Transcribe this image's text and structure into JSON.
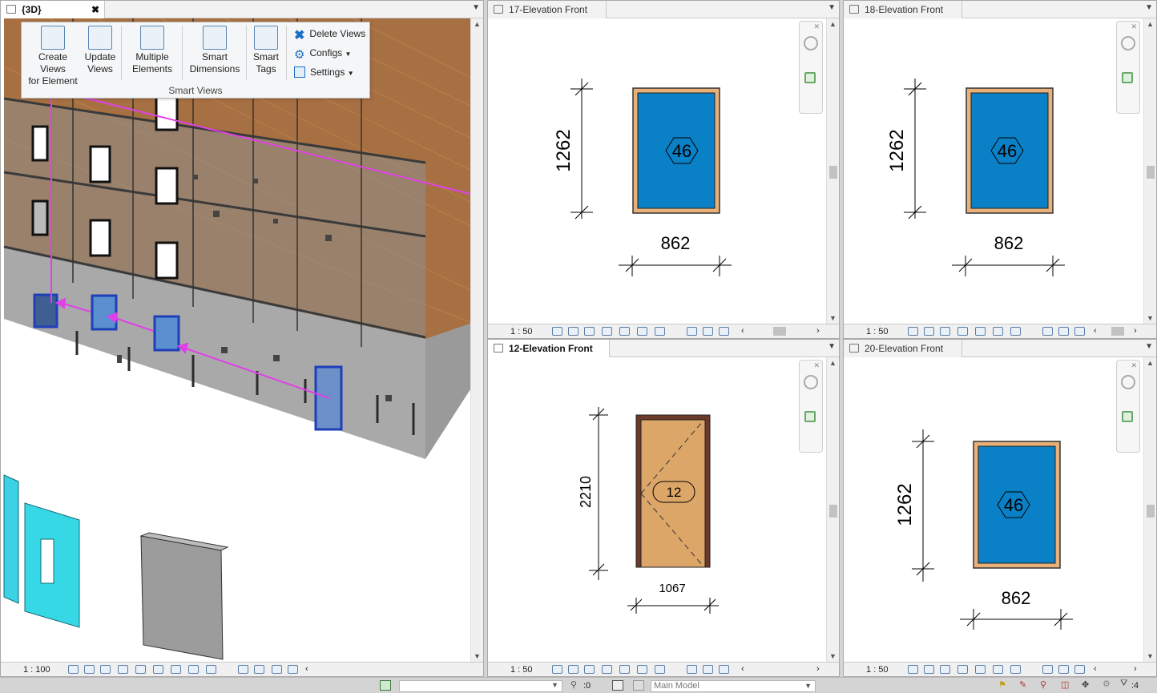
{
  "views": {
    "v3d": {
      "tab": "{3D}",
      "close": "✖",
      "scale": "1 : 100"
    },
    "e17": {
      "tab": "17-Elevation Front",
      "scale": "1 : 50",
      "height": "1262",
      "width": "862",
      "tag": "46"
    },
    "e18": {
      "tab": "18-Elevation Front",
      "scale": "1 : 50",
      "height": "1262",
      "width": "862",
      "tag": "46"
    },
    "e12": {
      "tab": "12-Elevation Front",
      "close": "✖",
      "scale": "1 : 50",
      "height": "2210",
      "width": "1067",
      "tag": "12"
    },
    "e20": {
      "tab": "20-Elevation Front",
      "scale": "1 : 50",
      "height": "1262",
      "width": "862",
      "tag": "46"
    }
  },
  "ribbon": {
    "create_views_line1": "Create Views",
    "create_views_line2": "for Element",
    "update_views_line1": "Update",
    "update_views_line2": "Views",
    "multiple_line1": "Multiple",
    "multiple_line2": "Elements",
    "smart_dim_line1": "Smart",
    "smart_dim_line2": "Dimensions",
    "smart_tags_line1": "Smart",
    "smart_tags_line2": "Tags",
    "delete_views": "Delete Views",
    "configs": "Configs",
    "settings": "Settings",
    "panel_label": "Smart Views"
  },
  "statusbar": {
    "selection_count": ":0",
    "model": "Main Model",
    "filter_count": ":4"
  },
  "colors": {
    "glass": "#0a80c6",
    "frame": "#e7b179",
    "door": "#dca669",
    "door_frame": "#6b3a2a",
    "arrow": "#e040e8",
    "wood": "#a77042"
  }
}
